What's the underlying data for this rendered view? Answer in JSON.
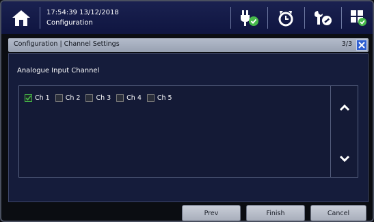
{
  "status": {
    "time": "17:54:39",
    "date": "13/12/2018",
    "context": "Configuration"
  },
  "toolbar_icons": [
    "power-ok-icon",
    "alarm-clock-icon",
    "wrench-icon",
    "grid-status-icon"
  ],
  "dialog": {
    "title": "Configuration | Channel Settings",
    "page": "3/3",
    "close": "×"
  },
  "section": {
    "label": "Analogue Input Channel",
    "channels": [
      {
        "label": "Ch 1",
        "checked": true
      },
      {
        "label": "Ch 2",
        "checked": false
      },
      {
        "label": "Ch 3",
        "checked": false
      },
      {
        "label": "Ch 4",
        "checked": false
      },
      {
        "label": "Ch 5",
        "checked": false
      }
    ]
  },
  "buttons": {
    "prev": "Prev",
    "finish": "Finish",
    "cancel": "Cancel"
  },
  "colors": {
    "topbar": "#141b48",
    "accent_green": "#46b84a",
    "close_blue": "#2f5fd1"
  }
}
